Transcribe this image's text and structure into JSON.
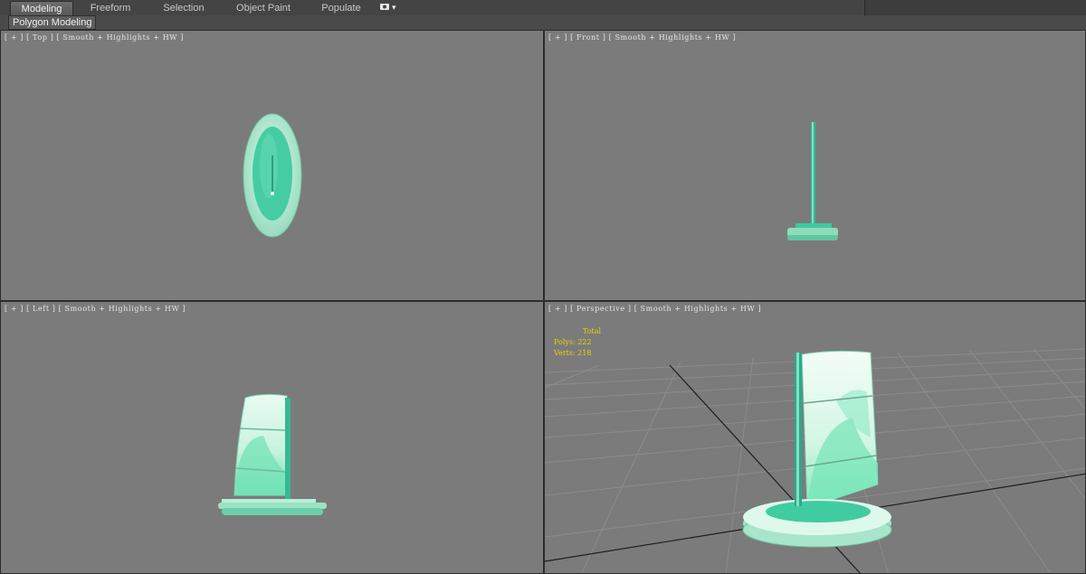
{
  "ribbon": {
    "tabs": [
      {
        "label": "Modeling",
        "active": true
      },
      {
        "label": "Freeform",
        "active": false
      },
      {
        "label": "Selection",
        "active": false
      },
      {
        "label": "Object Paint",
        "active": false
      },
      {
        "label": "Populate",
        "active": false
      }
    ],
    "dropdown_label": "▾",
    "panel_label": "Polygon Modeling"
  },
  "viewports": {
    "top": {
      "label": "[ + ] [ Top ] [ Smooth + Highlights + HW ]"
    },
    "front": {
      "label": "[ + ] [ Front ] [ Smooth + Highlights + HW ]"
    },
    "left": {
      "label": "[ + ] [ Left ] [ Smooth + Highlights + HW ]"
    },
    "perspective": {
      "label": "[ + ] [ Perspective ] [ Smooth + Highlights + HW ]",
      "stats": {
        "header": "Total",
        "polys_label": "Polys:",
        "polys_value": "222",
        "verts_label": "Verts:",
        "verts_value": "218"
      }
    }
  },
  "colors": {
    "viewport_bg": "#7b7b7b",
    "model_teal": "#3ec9a0",
    "model_light": "#b6f0d6",
    "stats_text": "#e8d400"
  }
}
